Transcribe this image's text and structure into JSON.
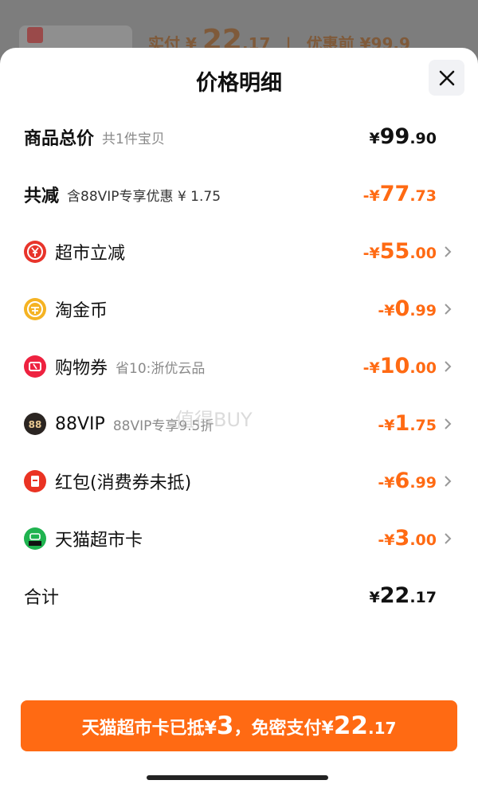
{
  "background": {
    "price_text": "实付",
    "currency": "¥",
    "price_int": "22",
    "price_dec": ".17",
    "separator": "|",
    "before_label": "优惠前",
    "before_price": "¥99.9"
  },
  "sheet": {
    "title": "价格明细",
    "close_icon": "close-icon"
  },
  "rows": [
    {
      "label": "商品总价",
      "sub": "共1件宝贝",
      "sign": "",
      "int": "99",
      "dec": ".90",
      "color": "dark"
    },
    {
      "label": "共减",
      "sub": "含88VIP专享优惠 ¥ 1.75",
      "sign": "-",
      "int": "77",
      "dec": ".73",
      "color": "orange"
    },
    {
      "label": "超市立减",
      "sub": "",
      "sign": "-",
      "int": "55",
      "dec": ".00",
      "icon": "red-yen-icon",
      "color": "orange"
    },
    {
      "label": "淘金币",
      "sub": "",
      "sign": "-",
      "int": "0",
      "dec": ".99",
      "icon": "gold-coin-icon",
      "color": "orange"
    },
    {
      "label": "购物券",
      "sub": "省10:浙优云品",
      "sign": "-",
      "int": "10",
      "dec": ".00",
      "icon": "coupon-icon",
      "color": "orange"
    },
    {
      "label": "88VIP",
      "sub": "88VIP专享9.5折",
      "sign": "-",
      "int": "1",
      "dec": ".75",
      "icon": "vip-88-icon",
      "color": "orange"
    },
    {
      "label": "红包(消费券未抵)",
      "sub": "",
      "sign": "-",
      "int": "6",
      "dec": ".99",
      "icon": "red-envelope-icon",
      "color": "orange"
    },
    {
      "label": "天猫超市卡",
      "sub": "",
      "sign": "-",
      "int": "3",
      "dec": ".00",
      "icon": "tmall-market-card-icon",
      "color": "orange"
    },
    {
      "label": "合计",
      "sub": "",
      "sign": "",
      "int": "22",
      "dec": ".17",
      "color": "dark"
    }
  ],
  "currency_symbol": "¥",
  "pay_button": {
    "part1": "天猫超市卡已抵 ",
    "sym1": "¥",
    "num1": "3",
    "part2": "，免密支付 ",
    "sym2": "¥",
    "num2": "22",
    "dec2": ".17"
  },
  "watermark": "值得BUY",
  "colors": {
    "accent": "#ff6a13",
    "text": "#111111",
    "sub_text": "#8a8a8a"
  }
}
